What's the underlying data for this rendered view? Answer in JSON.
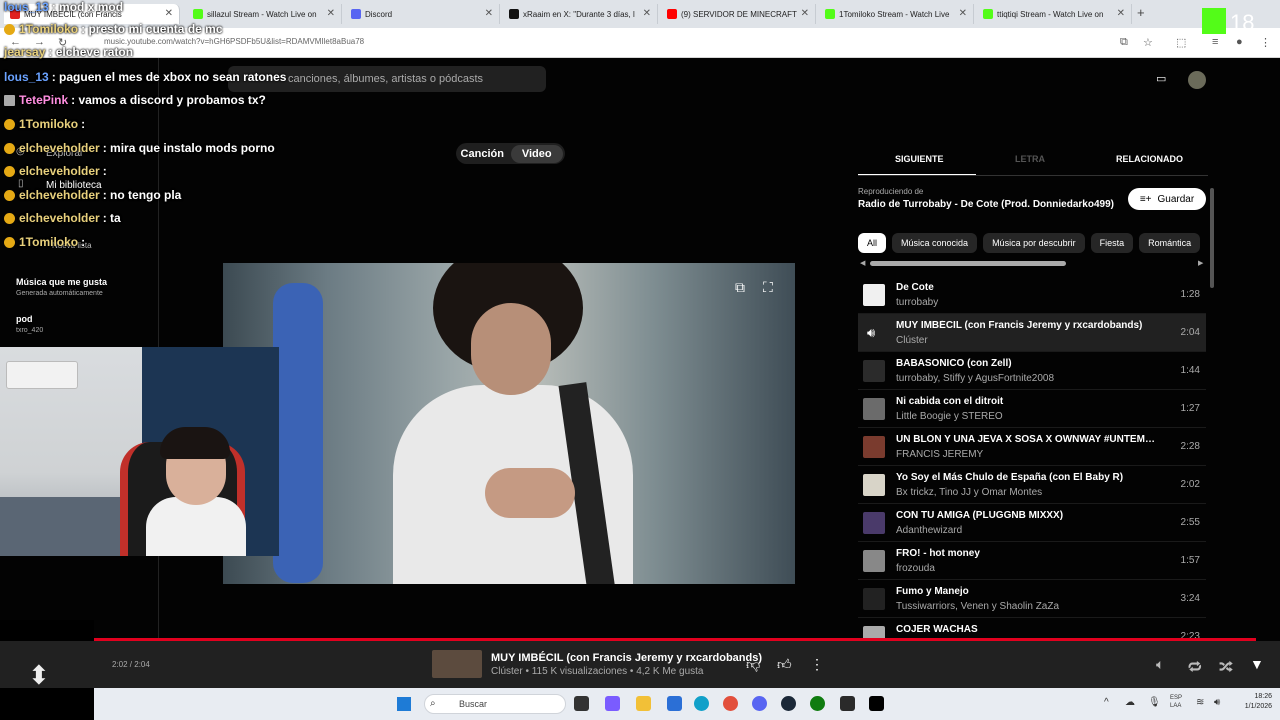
{
  "browser": {
    "tabs": [
      {
        "label": "MUY IMBÉCIL (con Francis",
        "color": "#e02020",
        "active": true
      },
      {
        "label": "sillazul Stream - Watch Live on",
        "color": "#53fc18"
      },
      {
        "label": "Discord",
        "color": "#5865f2"
      },
      {
        "label": "xRaaim en X: \"Durante 3 días, l",
        "color": "#111111"
      },
      {
        "label": "(9) SERVIDOR DE MINECRAFT",
        "color": "#ff0000"
      },
      {
        "label": "1Tomiloko Stream - Watch Live",
        "color": "#53fc18"
      },
      {
        "label": "ttiqtiqi Stream - Watch Live on",
        "color": "#53fc18"
      }
    ],
    "url": "music.youtube.com/watch?v=hGH6PSDFb5U&list=RDAMVMIlet8aBua78"
  },
  "overlay": {
    "age_badge": "18"
  },
  "chat": [
    {
      "user": "lous_13",
      "message": ": mod x mod",
      "color": "#6aa2ff",
      "badge": "none"
    },
    {
      "user": "1Tomiloko",
      "message": ": presto mi cuenta de mc",
      "color": "#e8d07c",
      "badge": "gold"
    },
    {
      "user": "jearsay",
      "message": ": elcheve raton",
      "color": "#e8d07c",
      "badge": "none"
    },
    {
      "user": "lous_13",
      "message": ": paguen el mes de xbox no sean ratones",
      "color": "#6aa2ff",
      "badge": "none"
    },
    {
      "user": "TetePink",
      "message": ": vamos a discord y probamos tx?",
      "color": "#ff8ee0",
      "badge": "gray"
    },
    {
      "user": "1Tomiloko",
      "message": ":",
      "color": "#e8d07c",
      "badge": "gold"
    },
    {
      "user": "elcheveholder",
      "message": ": mira que instalo mods porno",
      "color": "#e8d07c",
      "badge": "gold"
    },
    {
      "user": "elcheveholder",
      "message": ":",
      "color": "#e8d07c",
      "badge": "gold"
    },
    {
      "user": "elcheveholder",
      "message": ": no tengo pla",
      "color": "#e8d07c",
      "badge": "gold"
    },
    {
      "user": "elcheveholder",
      "message": ": ta",
      "color": "#e8d07c",
      "badge": "gold"
    },
    {
      "user": "1Tomiloko",
      "message": ":",
      "color": "#e8d07c",
      "badge": "gold"
    }
  ],
  "ytm": {
    "search_placeholder": "canciones, álbumes, artistas o pódcasts",
    "sidebar": {
      "explore": "Explorar",
      "library": "Mi biblioteca",
      "new_playlist": "Nueva lista",
      "playlists": [
        {
          "title": "Música que me gusta",
          "sub": "Generada automáticamente"
        },
        {
          "title": "pod",
          "sub": "txro_420"
        }
      ]
    },
    "toggle": {
      "song": "Canción",
      "video": "Video"
    },
    "panel": {
      "tab_next": "SIGUIENTE",
      "tab_lyrics": "LETRA",
      "tab_related": "RELACIONADO",
      "playing_from": "Reproduciendo de",
      "playing_from_title": "Radio de Turrobaby - De Cote (Prod. Donniedarko499)",
      "save": "Guardar",
      "chips": [
        "All",
        "Música conocida",
        "Música por descubrir",
        "Fiesta",
        "Romántica"
      ],
      "queue": [
        {
          "title": "De Cote",
          "artist": "turrobaby",
          "duration": "1:28",
          "thumb": "#f0f0f0",
          "now": false
        },
        {
          "title": "MUY IMBÉCIL (con Francis Jeremy y rxcardobands)",
          "artist": "Clúster",
          "duration": "2:04",
          "thumb": "#333333",
          "now": true
        },
        {
          "title": "BABASONICO (con Zell)",
          "artist": "turrobaby, Stiffy y AgusFortnite2008",
          "duration": "1:44",
          "thumb": "#2b2b2b",
          "now": false
        },
        {
          "title": "Ni cabida con el ditroit",
          "artist": "Little Boogie y STEREO",
          "duration": "1:27",
          "thumb": "#6b6b6b",
          "now": false
        },
        {
          "title": "UN BLON Y UNA JEVA X SOSA X OWNWAY #UNTEMA...",
          "artist": "FRANCIS JEREMY",
          "duration": "2:28",
          "thumb": "#7a3b2e",
          "now": false
        },
        {
          "title": "Yo Soy el Más Chulo de España (con El Baby R)",
          "artist": "Bx trickz, Tino JJ y Omar Montes",
          "duration": "2:02",
          "thumb": "#d8d4c8",
          "now": false
        },
        {
          "title": "CON TU AMIGA (PLUGGNB MIXXX)",
          "artist": "Adanthewizard",
          "duration": "2:55",
          "thumb": "#4a3a6a",
          "now": false
        },
        {
          "title": "FRO! - hot money",
          "artist": "frozouda",
          "duration": "1:57",
          "thumb": "#888888",
          "now": false
        },
        {
          "title": "Fumo y Manejo",
          "artist": "Tussiwarriors, Venen y Shaolin ZaZa",
          "duration": "3:24",
          "thumb": "#222222",
          "now": false
        },
        {
          "title": "COJER WACHAS",
          "artist": "",
          "duration": "2:23",
          "thumb": "#aaaaaa",
          "now": false
        }
      ]
    },
    "player": {
      "time": "2:02 / 2:04",
      "title": "MUY IMBÉCIL (con Francis Jeremy y rxcardobands)",
      "subtitle": "Clúster • 115 K visualizaciones • 4,2 K Me gusta",
      "progress": 0.98
    }
  },
  "taskbar": {
    "search": "Buscar",
    "lang_1": "ESP",
    "lang_2": "LAA",
    "time": "18:26",
    "date": "1/1/2026"
  },
  "colors": {
    "accent_red": "#e2001e",
    "kick_green": "#53fc18"
  }
}
